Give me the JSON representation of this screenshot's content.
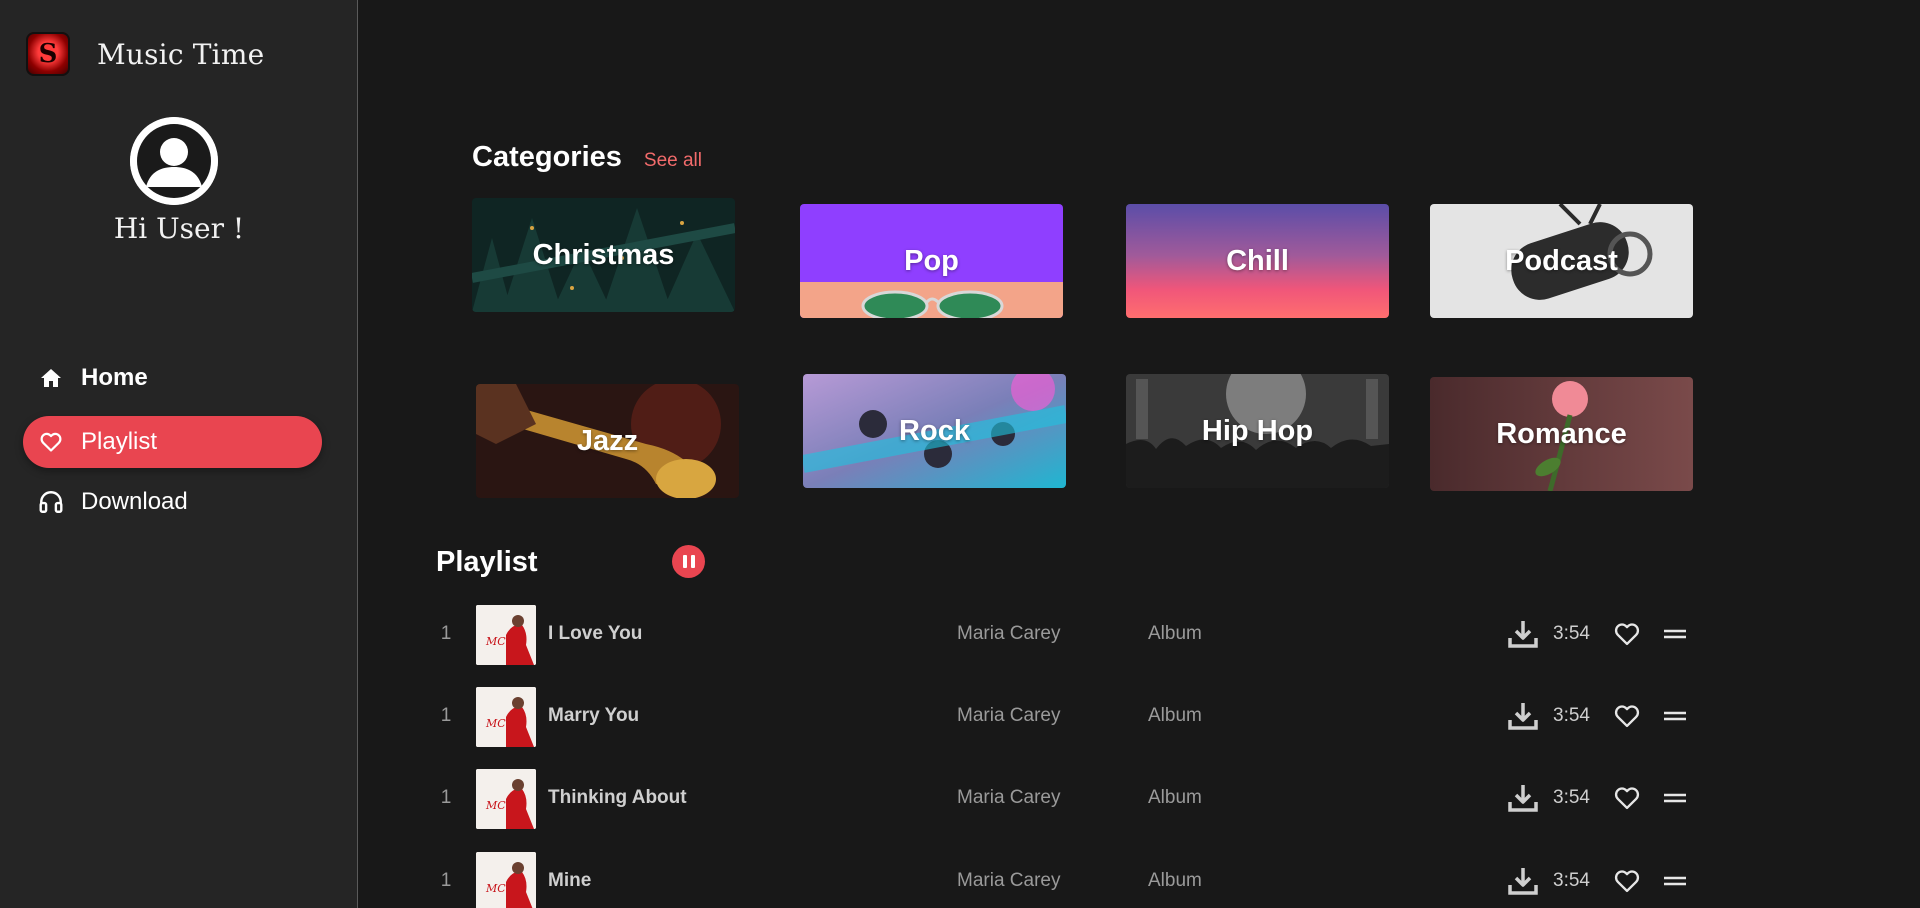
{
  "app": {
    "name": "Music Time"
  },
  "user": {
    "greeting": "Hi User !"
  },
  "nav": {
    "items": [
      {
        "label": "Home",
        "icon": "home-icon",
        "active": false
      },
      {
        "label": "Playlist",
        "icon": "heart-icon",
        "active": true
      },
      {
        "label": "Download",
        "icon": "headphones-icon",
        "active": false
      }
    ]
  },
  "categories": {
    "title": "Categories",
    "see_all": "See all",
    "items": [
      {
        "label": "Christmas"
      },
      {
        "label": "Pop"
      },
      {
        "label": "Chill"
      },
      {
        "label": "Podcast"
      },
      {
        "label": "Jazz"
      },
      {
        "label": "Rock"
      },
      {
        "label": "Hip Hop"
      },
      {
        "label": "Romance"
      }
    ]
  },
  "playlist": {
    "title": "Playlist",
    "tracks": [
      {
        "num": "1",
        "title": "I Love You",
        "artist": "Maria Carey",
        "album": "Album",
        "duration": "3:54"
      },
      {
        "num": "1",
        "title": "Marry You",
        "artist": "Maria Carey",
        "album": "Album",
        "duration": "3:54"
      },
      {
        "num": "1",
        "title": "Thinking About",
        "artist": "Maria Carey",
        "album": "Album",
        "duration": "3:54"
      },
      {
        "num": "1",
        "title": "Mine",
        "artist": "Maria Carey",
        "album": "Album",
        "duration": "3:54"
      }
    ]
  },
  "colors": {
    "accent": "#e94550",
    "sidebar": "#252525",
    "background": "#181818",
    "link": "#f26b6b"
  }
}
